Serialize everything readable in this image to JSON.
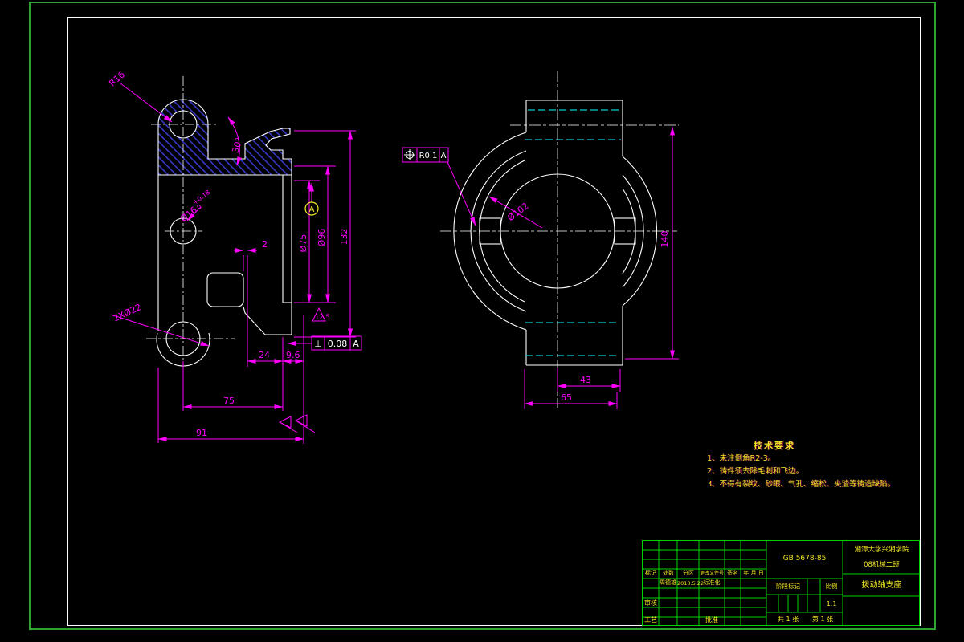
{
  "palette": {
    "background": "#000000",
    "object_lines": "#ffffff",
    "dimension_lines": "#ff00ff",
    "hatch": "#3b3bd8",
    "hidden_lines": "#00cccc",
    "outer_border": "#2fa32f",
    "table_lines": "#00d400",
    "table_text": "#f2e623"
  },
  "left_view": {
    "radius_label": "R16",
    "angle_label": "30°",
    "bore_label": "Ø16",
    "bore_tol_upper": "+0.18",
    "bore_tol_lower": "0",
    "holes_label": "2XØ22",
    "datum_label": "A",
    "dia_75": "Ø75",
    "dia_96": "Ø96",
    "height_132": "132",
    "dim_2": "2",
    "dim_24": "24",
    "dim_9_6": "9.6",
    "dim_75": "75",
    "dim_91": "91",
    "finish": "12.5",
    "perp_symbol": "⊥",
    "perp_value": "0.08",
    "perp_datum": "A"
  },
  "right_view": {
    "dia_102": "Ø102",
    "dim_140": "140",
    "dim_43": "43",
    "dim_65": "65",
    "pos_value": "R0.1",
    "pos_datum": "A"
  },
  "notes": {
    "title": "技术要求",
    "items": [
      "1、未注倒角R2-3。",
      "2、铸件须去除毛刺和飞边。",
      "3、不得有裂纹、砂眼、气孔、缩松、夹渣等铸造缺陷。"
    ]
  },
  "title_block": {
    "standard": "GB 5678-85",
    "school": "湘潭大学兴湘学院",
    "class_name": "08机械二班",
    "part_name": "拨动轴支座",
    "col_mark": "标记",
    "col_count": "处数",
    "col_zone": "分区",
    "col_doc": "更改文件号",
    "col_sign": "签名",
    "col_date": "年 月 日",
    "designer_name": "周德雄",
    "design_date": "2010.5.22",
    "standardization": "标准化",
    "check": "审核",
    "process": "工艺",
    "approve": "批准",
    "stage_label": "阶段标记",
    "scale_label": "比例",
    "scale_value": "1:1",
    "sheet_total": "共 1 张",
    "sheet_no": "第 1 张"
  }
}
